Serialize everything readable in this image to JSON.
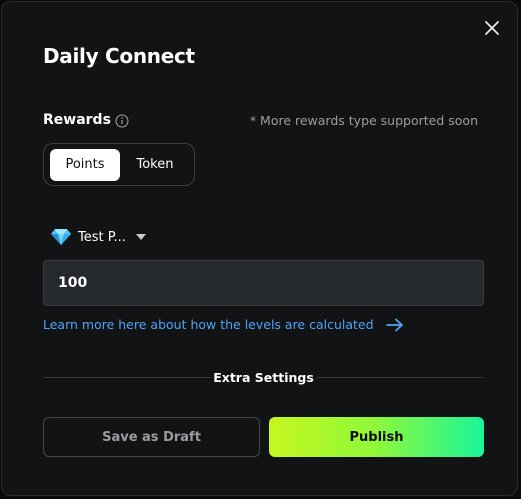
{
  "dialog": {
    "title": "Daily Connect"
  },
  "rewards": {
    "label": "Rewards",
    "note": "* More rewards type supported soon",
    "options": [
      "Points",
      "Token"
    ],
    "selected": "Points"
  },
  "point_type": {
    "icon": "gem-icon",
    "label": "Test P..."
  },
  "amount": {
    "value": "100"
  },
  "learn_more": {
    "text": "Learn more here about how the levels are calculated",
    "color": "#4fa3f7"
  },
  "extra_settings": {
    "label": "Extra Settings"
  },
  "actions": {
    "draft_label": "Save as Draft",
    "publish_label": "Publish"
  },
  "colors": {
    "background": "#121314",
    "accent_gradient_start": "#c6f71e",
    "accent_gradient_end": "#19f59a",
    "input_bg": "#25282c"
  }
}
